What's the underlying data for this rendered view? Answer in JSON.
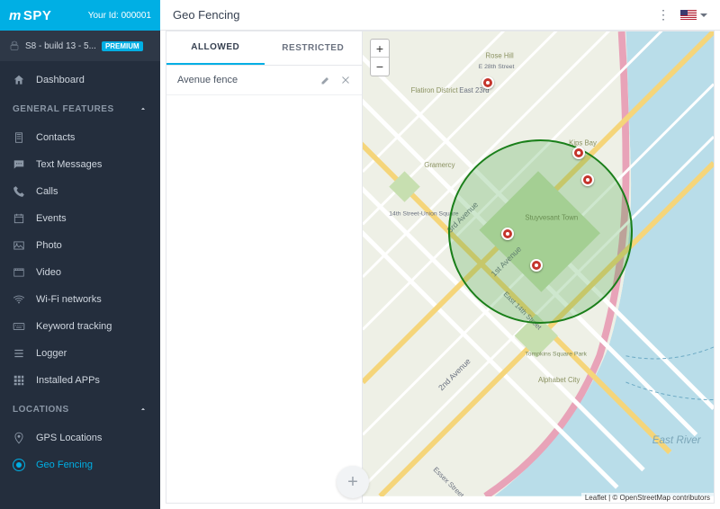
{
  "brand": {
    "name": "mSPY",
    "your_id_label": "Your Id:",
    "your_id": "000001"
  },
  "device": {
    "label": "S8 - build 13 - 5...",
    "badge": "PREMIUM"
  },
  "nav": {
    "dashboard": "Dashboard",
    "section_general": "GENERAL FEATURES",
    "contacts": "Contacts",
    "text_messages": "Text Messages",
    "calls": "Calls",
    "events": "Events",
    "photo": "Photo",
    "video": "Video",
    "wifi": "Wi-Fi networks",
    "keyword": "Keyword tracking",
    "logger": "Logger",
    "installed_apps": "Installed APPs",
    "section_locations": "LOCATIONS",
    "gps": "GPS Locations",
    "geo_fencing": "Geo Fencing"
  },
  "header": {
    "title": "Geo Fencing"
  },
  "tabs": {
    "allowed": "ALLOWED",
    "restricted": "RESTRICTED"
  },
  "fences": [
    {
      "name": "Avenue fence"
    }
  ],
  "map": {
    "attribution": "Leaflet | © OpenStreetMap contributors",
    "labels": {
      "east_river": "East River",
      "first_ave": "1st Avenue",
      "second_ave": "2nd Avenue",
      "third_ave": "3rd Avenue",
      "e28": "E 28th Street",
      "e23": "East 23rd",
      "e14": "East 14th Street",
      "essex": "Essex Street",
      "stuy": "Stuyvesant Town",
      "flatiron": "Flatiron District",
      "gramercy": "Gramercy",
      "rosehill": "Rose Hill",
      "kips": "Kips Bay",
      "tompkins": "Tompkins Square Park",
      "alphabet": "Alphabet City",
      "union": "14th Street-Union Square"
    }
  },
  "zoom": {
    "in": "+",
    "out": "−"
  },
  "fab": "+"
}
